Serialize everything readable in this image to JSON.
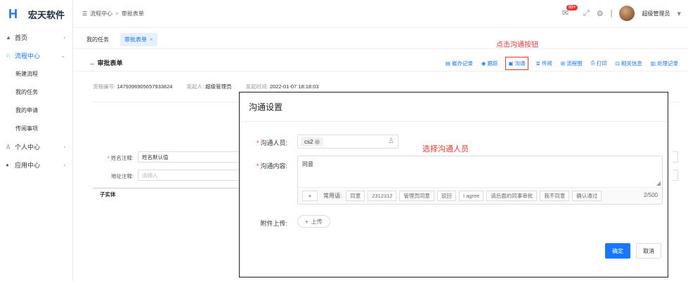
{
  "app": {
    "brand": "宏天软件",
    "logo_glyph": "H"
  },
  "sidebar": {
    "items": [
      {
        "label": "首页"
      },
      {
        "label": "流程中心"
      },
      {
        "label": "个人中心"
      },
      {
        "label": "应用中心"
      }
    ],
    "sub_items": [
      {
        "label": "新建流程"
      },
      {
        "label": "我的任务"
      },
      {
        "label": "我的申请"
      },
      {
        "label": "传阅事项"
      }
    ]
  },
  "header": {
    "breadcrumb": [
      "流程中心",
      "审批表单"
    ],
    "badge": "99+",
    "user": "超级管理员"
  },
  "tabs": [
    {
      "label": "我的任务"
    },
    {
      "label": "审批表单"
    }
  ],
  "annotations": {
    "click_hint": "点击沟通按钮",
    "select_hint": "选择沟通人员"
  },
  "page": {
    "title": "审批表单",
    "actions": [
      {
        "label": "催办记录"
      },
      {
        "label": "跟踪"
      },
      {
        "label": "沟通"
      },
      {
        "label": "传阅"
      },
      {
        "label": "流程图"
      },
      {
        "label": "打印"
      },
      {
        "label": "相关信息"
      },
      {
        "label": "处理记录"
      }
    ],
    "meta": {
      "flow_no_label": "流程编号:",
      "flow_no": "1479396905657933824",
      "initiator_label": "发起人:",
      "initiator": "超级管理员",
      "time_label": "发起时间:",
      "time": "2022-01-07 18:18:03"
    },
    "form": {
      "name_label": "姓名注释:",
      "name_value": "姓名默认值",
      "addr_label": "地址注释:",
      "addr_placeholder": "请输入",
      "child_entity": "子实体"
    }
  },
  "modal": {
    "title": "沟通设置",
    "person_label": "沟通人员:",
    "person_tag": "cs2",
    "content_label": "沟通内容:",
    "content_value": "同意",
    "phrase_label": "常用语:",
    "phrases": [
      "同意",
      "2312312",
      "管理员同意",
      "驳回",
      "I agree",
      "请后面的同事审批",
      "我不同意",
      "确认通过"
    ],
    "counter": "2/500",
    "upload_label": "附件上传:",
    "upload_button": "上传",
    "ok": "确定",
    "cancel": "取消"
  }
}
